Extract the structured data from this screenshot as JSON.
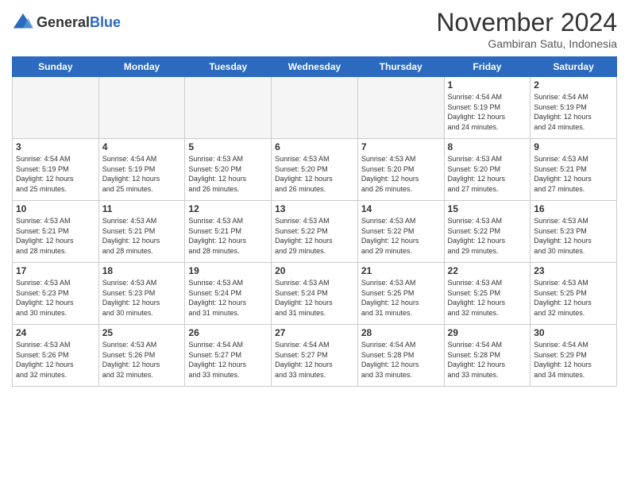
{
  "header": {
    "logo_line1": "General",
    "logo_line2": "Blue",
    "month": "November 2024",
    "location": "Gambiran Satu, Indonesia"
  },
  "weekdays": [
    "Sunday",
    "Monday",
    "Tuesday",
    "Wednesday",
    "Thursday",
    "Friday",
    "Saturday"
  ],
  "weeks": [
    [
      {
        "day": "",
        "content": ""
      },
      {
        "day": "",
        "content": ""
      },
      {
        "day": "",
        "content": ""
      },
      {
        "day": "",
        "content": ""
      },
      {
        "day": "",
        "content": ""
      },
      {
        "day": "1",
        "content": "Sunrise: 4:54 AM\nSunset: 5:19 PM\nDaylight: 12 hours\nand 24 minutes."
      },
      {
        "day": "2",
        "content": "Sunrise: 4:54 AM\nSunset: 5:19 PM\nDaylight: 12 hours\nand 24 minutes."
      }
    ],
    [
      {
        "day": "3",
        "content": "Sunrise: 4:54 AM\nSunset: 5:19 PM\nDaylight: 12 hours\nand 25 minutes."
      },
      {
        "day": "4",
        "content": "Sunrise: 4:54 AM\nSunset: 5:19 PM\nDaylight: 12 hours\nand 25 minutes."
      },
      {
        "day": "5",
        "content": "Sunrise: 4:53 AM\nSunset: 5:20 PM\nDaylight: 12 hours\nand 26 minutes."
      },
      {
        "day": "6",
        "content": "Sunrise: 4:53 AM\nSunset: 5:20 PM\nDaylight: 12 hours\nand 26 minutes."
      },
      {
        "day": "7",
        "content": "Sunrise: 4:53 AM\nSunset: 5:20 PM\nDaylight: 12 hours\nand 26 minutes."
      },
      {
        "day": "8",
        "content": "Sunrise: 4:53 AM\nSunset: 5:20 PM\nDaylight: 12 hours\nand 27 minutes."
      },
      {
        "day": "9",
        "content": "Sunrise: 4:53 AM\nSunset: 5:21 PM\nDaylight: 12 hours\nand 27 minutes."
      }
    ],
    [
      {
        "day": "10",
        "content": "Sunrise: 4:53 AM\nSunset: 5:21 PM\nDaylight: 12 hours\nand 28 minutes."
      },
      {
        "day": "11",
        "content": "Sunrise: 4:53 AM\nSunset: 5:21 PM\nDaylight: 12 hours\nand 28 minutes."
      },
      {
        "day": "12",
        "content": "Sunrise: 4:53 AM\nSunset: 5:21 PM\nDaylight: 12 hours\nand 28 minutes."
      },
      {
        "day": "13",
        "content": "Sunrise: 4:53 AM\nSunset: 5:22 PM\nDaylight: 12 hours\nand 29 minutes."
      },
      {
        "day": "14",
        "content": "Sunrise: 4:53 AM\nSunset: 5:22 PM\nDaylight: 12 hours\nand 29 minutes."
      },
      {
        "day": "15",
        "content": "Sunrise: 4:53 AM\nSunset: 5:22 PM\nDaylight: 12 hours\nand 29 minutes."
      },
      {
        "day": "16",
        "content": "Sunrise: 4:53 AM\nSunset: 5:23 PM\nDaylight: 12 hours\nand 30 minutes."
      }
    ],
    [
      {
        "day": "17",
        "content": "Sunrise: 4:53 AM\nSunset: 5:23 PM\nDaylight: 12 hours\nand 30 minutes."
      },
      {
        "day": "18",
        "content": "Sunrise: 4:53 AM\nSunset: 5:23 PM\nDaylight: 12 hours\nand 30 minutes."
      },
      {
        "day": "19",
        "content": "Sunrise: 4:53 AM\nSunset: 5:24 PM\nDaylight: 12 hours\nand 31 minutes."
      },
      {
        "day": "20",
        "content": "Sunrise: 4:53 AM\nSunset: 5:24 PM\nDaylight: 12 hours\nand 31 minutes."
      },
      {
        "day": "21",
        "content": "Sunrise: 4:53 AM\nSunset: 5:25 PM\nDaylight: 12 hours\nand 31 minutes."
      },
      {
        "day": "22",
        "content": "Sunrise: 4:53 AM\nSunset: 5:25 PM\nDaylight: 12 hours\nand 32 minutes."
      },
      {
        "day": "23",
        "content": "Sunrise: 4:53 AM\nSunset: 5:25 PM\nDaylight: 12 hours\nand 32 minutes."
      }
    ],
    [
      {
        "day": "24",
        "content": "Sunrise: 4:53 AM\nSunset: 5:26 PM\nDaylight: 12 hours\nand 32 minutes."
      },
      {
        "day": "25",
        "content": "Sunrise: 4:53 AM\nSunset: 5:26 PM\nDaylight: 12 hours\nand 32 minutes."
      },
      {
        "day": "26",
        "content": "Sunrise: 4:54 AM\nSunset: 5:27 PM\nDaylight: 12 hours\nand 33 minutes."
      },
      {
        "day": "27",
        "content": "Sunrise: 4:54 AM\nSunset: 5:27 PM\nDaylight: 12 hours\nand 33 minutes."
      },
      {
        "day": "28",
        "content": "Sunrise: 4:54 AM\nSunset: 5:28 PM\nDaylight: 12 hours\nand 33 minutes."
      },
      {
        "day": "29",
        "content": "Sunrise: 4:54 AM\nSunset: 5:28 PM\nDaylight: 12 hours\nand 33 minutes."
      },
      {
        "day": "30",
        "content": "Sunrise: 4:54 AM\nSunset: 5:29 PM\nDaylight: 12 hours\nand 34 minutes."
      }
    ]
  ]
}
